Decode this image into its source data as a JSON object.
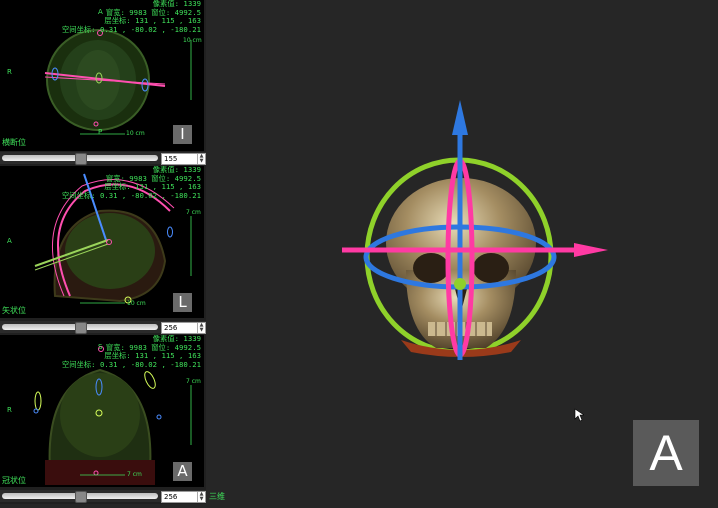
{
  "info": {
    "pixel_value": "像素值: 1339",
    "window": "窗宽: 9983 窗位: 4992.5",
    "layer_coords": "层坐标: 131 , 115 , 163",
    "space_coords": "空间坐标: 0.31 , -80.02 , -180.21"
  },
  "views": [
    {
      "plane": "横断位",
      "badge": "I",
      "side_left": "R",
      "side_top": "A",
      "side_bottom": "P",
      "scale_right": "10 cm",
      "scale_bottom": "10 cm",
      "slice": "155",
      "slice_fraction": 0.49
    },
    {
      "plane": "矢状位",
      "badge": "L",
      "side_left": "A",
      "scale_right": "7 cm",
      "scale_bottom": "10 cm",
      "slice": "256",
      "slice_fraction": 0.49
    },
    {
      "plane": "冠状位",
      "badge": "A",
      "side_left": "R",
      "side_top": "S",
      "scale_right": "7 cm",
      "scale_bottom": "7 cm",
      "slice": "256",
      "slice_fraction": 0.49
    }
  ],
  "main_view": {
    "label_3d": "三维",
    "orientation_badge": "A"
  }
}
